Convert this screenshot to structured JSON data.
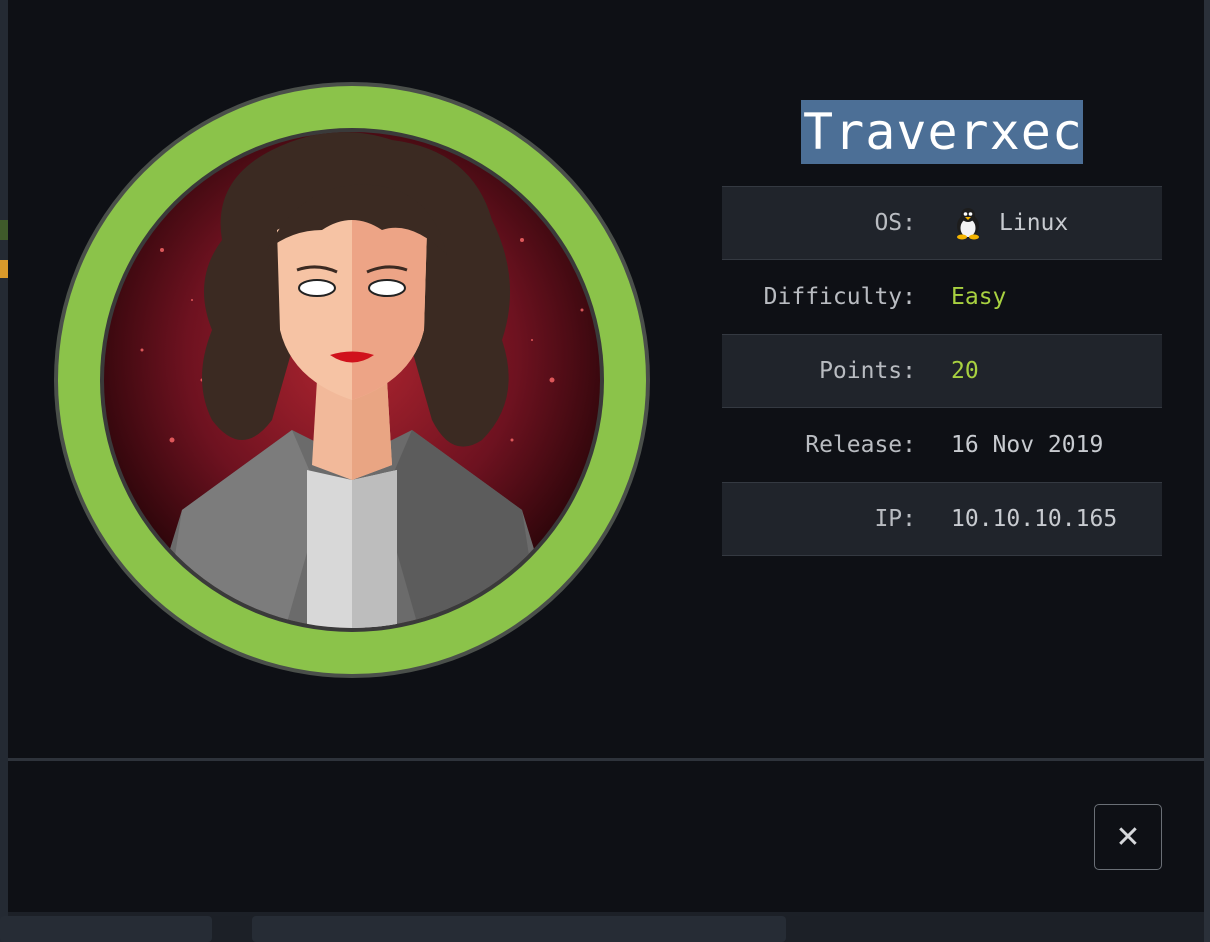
{
  "machine": {
    "name": "Traverxec",
    "avatar_icon": "machine-avatar-woman-icon"
  },
  "info": {
    "os": {
      "label": "OS:",
      "value": "Linux",
      "icon": "tux-linux-icon"
    },
    "difficulty": {
      "label": "Difficulty:",
      "value": "Easy"
    },
    "points": {
      "label": "Points:",
      "value": "20"
    },
    "release": {
      "label": "Release:",
      "value": "16 Nov 2019"
    },
    "ip": {
      "label": "IP:",
      "value": "10.10.10.165"
    }
  },
  "close_button": {
    "glyph": "✕",
    "icon": "close-icon"
  },
  "colors": {
    "modal_background": "#0e1015",
    "title_highlight": "#4c6f96",
    "accent_green": "#a8d140",
    "avatar_ring": "#8bc34a",
    "avatar_background": "#7a1520"
  }
}
